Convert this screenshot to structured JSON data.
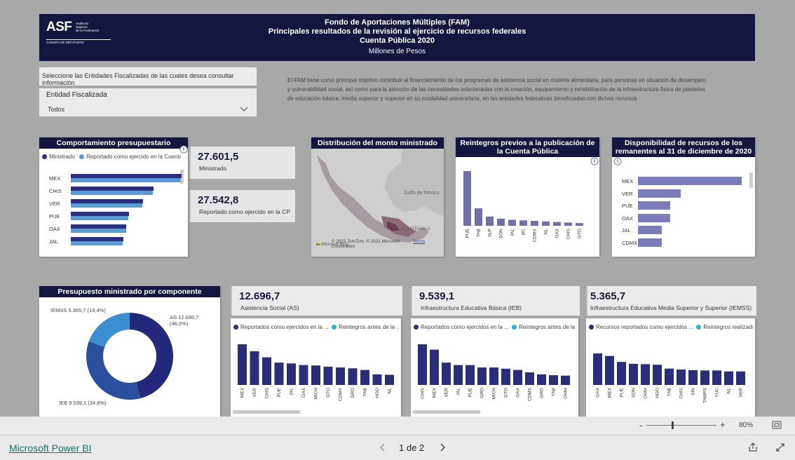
{
  "header": {
    "logo": {
      "text": "ASF",
      "sub": [
        "Auditoría",
        "Superior",
        "de la Federación",
        "CÁMARA DE DIPUTADOS"
      ]
    },
    "lines": [
      "Fondo de Aportaciones Múltiples (FAM)",
      "Principales resultados de la revisión al ejercicio de recursos federales",
      "Cuenta Pública 2020"
    ],
    "units": "Millones de Pesos"
  },
  "slicer": {
    "prompt": "Seleccione las Entidades Fiscalizadas de las cuales desea consultar información",
    "label": "Entidad Fiscalizada",
    "value": "Todos"
  },
  "description": "El FAM tiene como principal objetivo contribuir al financiamiento de los programas de asistencia social en materia alimentaria, para personas en situación de desamparo y vulnerabilidad social, así como para la atención de las necesidades relacionadas con la creación, equipamiento y rehabilitación de la infraestructura física de planteles de educación básica, media superior y superior en su modalidad universitaria, en las entidades federativas beneficiadas con dichos recursos.",
  "comportamiento": {
    "title": "Comportamiento presupuestario",
    "legend": [
      "Ministrado",
      "Reportado como ejercido en la Cuenta..."
    ],
    "colors": [
      "#2b2f7d",
      "#5b9bd5"
    ],
    "chart_data": {
      "type": "bar",
      "categories": [
        "MEX",
        "CHIS",
        "VER",
        "PUE",
        "OAX",
        "JAL"
      ],
      "series": [
        {
          "name": "Ministrado",
          "values": [
            3150,
            2350,
            2050,
            1650,
            1580,
            1490
          ]
        },
        {
          "name": "Reportado como ejercido en la Cuenta...",
          "values": [
            3140,
            2340,
            2040,
            1640,
            1570,
            1480
          ]
        }
      ]
    }
  },
  "kpi1": {
    "value": "27.601,5",
    "label": "Ministrado"
  },
  "kpi2": {
    "value": "27.542,8",
    "label": "Reportado como ejercido en la CP"
  },
  "mapa": {
    "title": "Distribución del monto ministrado",
    "gulf": "Golfo de México",
    "guate": "GUATEMALA",
    "copyright": "© 2023 TomTom, © 2023 Microsoft Corporation",
    "terms": "Terms",
    "bing": "Microsoft Bing"
  },
  "reintegros": {
    "title": "Reintegros previos a la publicación de la Cuenta Pública",
    "color": "#6f6faa",
    "chart_data": {
      "type": "bar",
      "categories": [
        "PUE",
        "TAB",
        "SLP",
        "SON",
        "JAL",
        "BC",
        "CDMX",
        "NL",
        "OAX",
        "CHIS",
        "GTO"
      ],
      "values": [
        100,
        32,
        17,
        13,
        11,
        10,
        9,
        8,
        7,
        6,
        5
      ]
    }
  },
  "disponibilidad": {
    "title": "Disponibilidad de recursos de los remanentes al 31 de diciembre de 2020",
    "color": "#7c7cb8",
    "chart_data": {
      "type": "bar",
      "categories": [
        "MEX",
        "VER",
        "PUE",
        "OAX",
        "JAL",
        "CDMX"
      ],
      "values": [
        100,
        41,
        31,
        31,
        23,
        23
      ]
    }
  },
  "donut": {
    "title": "Presupuesto ministrado por componente",
    "labels": [
      "AS 12.696,7 (46,0%)",
      "IEB 9.539,1 (34,6%)",
      "IEMSS 5.365,7 (19,4%)"
    ],
    "colors": [
      "#24287a",
      "#2b4f9c",
      "#3d8ed1"
    ],
    "chart_data": {
      "type": "pie",
      "categories": [
        "AS",
        "IEB",
        "IEMSS"
      ],
      "values": [
        12696.7,
        9539.1,
        5365.7
      ]
    }
  },
  "as": {
    "value": "12.696,7",
    "label": "Asistencia Social (AS)",
    "legend": [
      "Reportados como ejercidos en la ...",
      "Reintegros antes de la ..."
    ],
    "chart_data": {
      "type": "bar",
      "categories": [
        "MEX",
        "VER",
        "CHIS",
        "PUE",
        "JAL",
        "OAX",
        "MICH",
        "GTO",
        "CDMX",
        "GRO",
        "TAB",
        "HGO",
        "NL"
      ],
      "values": [
        100,
        83,
        68,
        55,
        53,
        49,
        48,
        45,
        43,
        41,
        37,
        26,
        25
      ]
    }
  },
  "ieb": {
    "value": "9.539,1",
    "label": "Infraestructura Educativa Básica (IEB)",
    "legend": [
      "Reportados como ejercidos en la ...",
      "Reintegros antes de la ..."
    ],
    "chart_data": {
      "type": "bar",
      "categories": [
        "CHIS",
        "MEX",
        "VER",
        "JAL",
        "PUE",
        "GRO",
        "MICH",
        "GTO",
        "OAX",
        "CDMX",
        "GRO",
        "TAB",
        "CHIH"
      ],
      "values": [
        100,
        87,
        55,
        49,
        49,
        43,
        43,
        40,
        37,
        31,
        26,
        24,
        23
      ]
    }
  },
  "iems": {
    "value": "5.365,7",
    "label": "Infraestructura Educativa Media Superior y Superior (IEMSS)",
    "legend": [
      "Recursos reportados como ejercidos ...",
      "Reintegros realizados a..."
    ],
    "chart_data": {
      "type": "bar",
      "categories": [
        "OAX",
        "MEX",
        "PUE",
        "SON",
        "CHIH",
        "HGO",
        "TAB",
        "CHIS",
        "SIN",
        "TAMPS",
        "YUC",
        "NL",
        "VER"
      ],
      "values": [
        100,
        92,
        73,
        67,
        66,
        64,
        52,
        49,
        47,
        46,
        46,
        43,
        43
      ]
    }
  },
  "bar_color": "#2a2d78",
  "legend_color2": "#2bb3d6",
  "zoom": "80%",
  "footer": {
    "brand": "Microsoft Power BI",
    "page": "1 de 2"
  }
}
